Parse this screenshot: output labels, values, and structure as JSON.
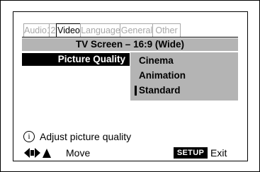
{
  "tabs": [
    {
      "label": "Audio1",
      "active": false
    },
    {
      "label": "2",
      "active": false
    },
    {
      "label": "Video",
      "active": true
    },
    {
      "label": "Language",
      "active": false
    },
    {
      "label": "General",
      "active": false
    },
    {
      "label": "Other",
      "active": false
    }
  ],
  "title": "TV Screen – 16:9 (Wide)",
  "setting": {
    "label": "Picture Quality",
    "options": [
      "Cinema",
      "Animation",
      "Standard"
    ],
    "selected": "Standard"
  },
  "help": {
    "icon": "info-icon",
    "text": "Adjust picture quality"
  },
  "footer": {
    "nav_icon": "arrow-keys-icon",
    "move_label": "Move",
    "setup_label": "SETUP",
    "exit_label": "Exit"
  },
  "colors": {
    "tab_inactive": "#a8a8a8",
    "highlight_gray": "#b4b4b4",
    "selected_bg": "#000000"
  }
}
